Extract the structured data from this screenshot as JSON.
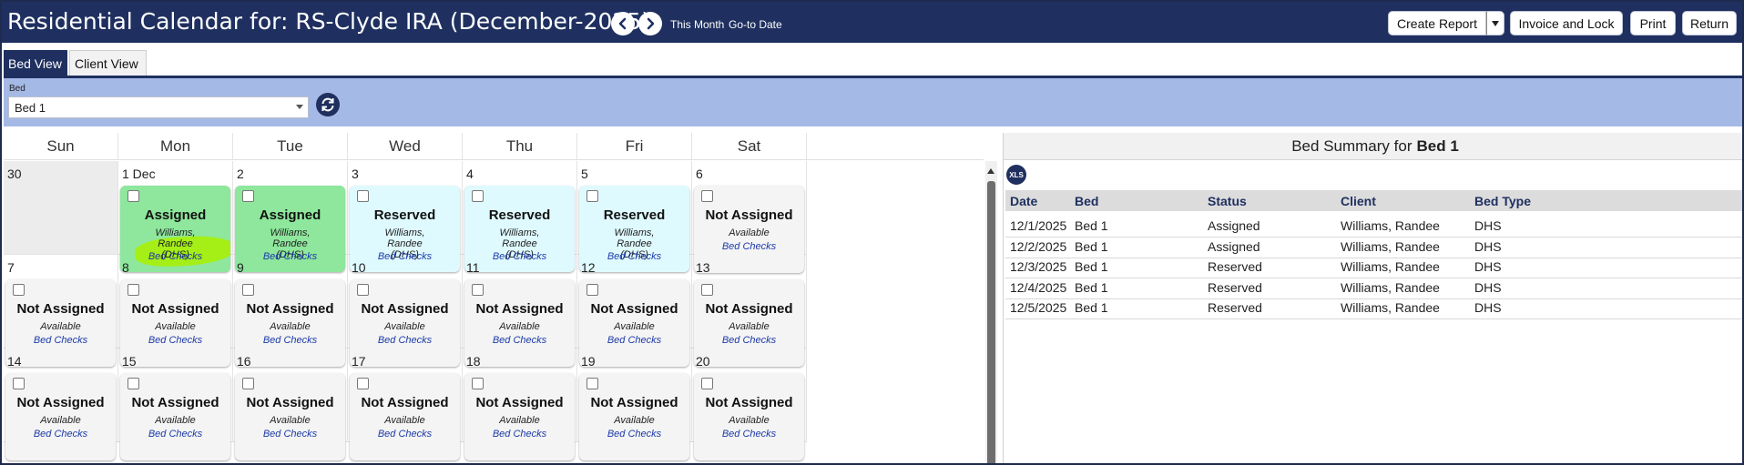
{
  "header": {
    "title": "Residential Calendar for: RS-Clyde IRA (December-2025)",
    "this_month": "This Month",
    "go_to_date": "Go-to Date",
    "buttons": {
      "create_report": "Create Report",
      "invoice_lock": "Invoice and Lock",
      "print": "Print",
      "return": "Return"
    }
  },
  "tabs": {
    "bed_view": "Bed View",
    "client_view": "Client View"
  },
  "filter": {
    "label": "Bed",
    "value": "Bed 1"
  },
  "calendar": {
    "days": [
      "Sun",
      "Mon",
      "Tue",
      "Wed",
      "Thu",
      "Fri",
      "Sat"
    ],
    "bed_checks_label": "Bed Checks",
    "weeks": [
      [
        {
          "day": "30",
          "prev": true
        },
        {
          "day": "1 Dec",
          "status": "Assigned",
          "client": "Williams, Randee (DHS)",
          "kind": "assigned",
          "highlight": true
        },
        {
          "day": "2",
          "status": "Assigned",
          "client": "Williams, Randee (DHS)",
          "kind": "assigned"
        },
        {
          "day": "3",
          "status": "Reserved",
          "client": "Williams, Randee (DHS)",
          "kind": "reserved"
        },
        {
          "day": "4",
          "status": "Reserved",
          "client": "Williams, Randee (DHS)",
          "kind": "reserved"
        },
        {
          "day": "5",
          "status": "Reserved",
          "client": "Williams, Randee (DHS)",
          "kind": "reserved"
        },
        {
          "day": "6",
          "status": "Not Assigned",
          "avail": "Available",
          "kind": "notassigned"
        }
      ],
      [
        {
          "day": "7",
          "status": "Not Assigned",
          "avail": "Available",
          "kind": "notassigned"
        },
        {
          "day": "8",
          "status": "Not Assigned",
          "avail": "Available",
          "kind": "notassigned"
        },
        {
          "day": "9",
          "status": "Not Assigned",
          "avail": "Available",
          "kind": "notassigned"
        },
        {
          "day": "10",
          "status": "Not Assigned",
          "avail": "Available",
          "kind": "notassigned"
        },
        {
          "day": "11",
          "status": "Not Assigned",
          "avail": "Available",
          "kind": "notassigned"
        },
        {
          "day": "12",
          "status": "Not Assigned",
          "avail": "Available",
          "kind": "notassigned"
        },
        {
          "day": "13",
          "status": "Not Assigned",
          "avail": "Available",
          "kind": "notassigned"
        }
      ],
      [
        {
          "day": "14",
          "status": "Not Assigned",
          "avail": "Available",
          "kind": "notassigned"
        },
        {
          "day": "15",
          "status": "Not Assigned",
          "avail": "Available",
          "kind": "notassigned"
        },
        {
          "day": "16",
          "status": "Not Assigned",
          "avail": "Available",
          "kind": "notassigned"
        },
        {
          "day": "17",
          "status": "Not Assigned",
          "avail": "Available",
          "kind": "notassigned"
        },
        {
          "day": "18",
          "status": "Not Assigned",
          "avail": "Available",
          "kind": "notassigned"
        },
        {
          "day": "19",
          "status": "Not Assigned",
          "avail": "Available",
          "kind": "notassigned"
        },
        {
          "day": "20",
          "status": "Not Assigned",
          "avail": "Available",
          "kind": "notassigned"
        }
      ]
    ]
  },
  "summary": {
    "title_prefix": "Bed Summary for",
    "title_bed": "Bed 1",
    "xls": "XLS",
    "columns": [
      "Date",
      "Bed",
      "Status",
      "Client",
      "Bed Type"
    ],
    "rows": [
      [
        "12/1/2025",
        "Bed 1",
        "Assigned",
        "Williams, Randee",
        "DHS"
      ],
      [
        "12/2/2025",
        "Bed 1",
        "Assigned",
        "Williams, Randee",
        "DHS"
      ],
      [
        "12/3/2025",
        "Bed 1",
        "Reserved",
        "Williams, Randee",
        "DHS"
      ],
      [
        "12/4/2025",
        "Bed 1",
        "Reserved",
        "Williams, Randee",
        "DHS"
      ],
      [
        "12/5/2025",
        "Bed 1",
        "Reserved",
        "Williams, Randee",
        "DHS"
      ]
    ]
  },
  "colors": {
    "header_bg": "#1f3060",
    "filter_bg": "#a5b9e6",
    "assigned": "#8ee79c",
    "reserved": "#dffaff",
    "not_assigned": "#f4f4f4",
    "link": "#1c3aa9",
    "highlight": "#a9f000"
  },
  "icons": {
    "prev": "chevron-left-icon",
    "next": "chevron-right-icon",
    "refresh": "refresh-icon",
    "export": "xls-icon"
  }
}
